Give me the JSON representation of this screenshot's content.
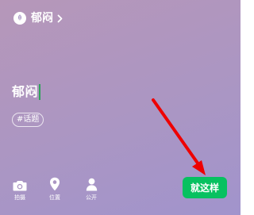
{
  "status_header": {
    "icon": "status-mood-icon",
    "name": "郁闷",
    "chevron_icon": "chevron-right-icon"
  },
  "editor": {
    "text": "郁闷"
  },
  "topic_tag": {
    "label": "#话题"
  },
  "toolbar": {
    "items": [
      {
        "icon": "camera-icon",
        "label": "拍摄"
      },
      {
        "icon": "location-pin-icon",
        "label": "位置"
      },
      {
        "icon": "person-icon",
        "label": "公开"
      }
    ]
  },
  "done_button": {
    "label": "就这样"
  },
  "colors": {
    "background_top": "#b697b9",
    "background_bottom": "#a194cc",
    "accent_green": "#07c160",
    "cursor_green": "#2ea35a",
    "arrow_red": "#ee0000"
  }
}
